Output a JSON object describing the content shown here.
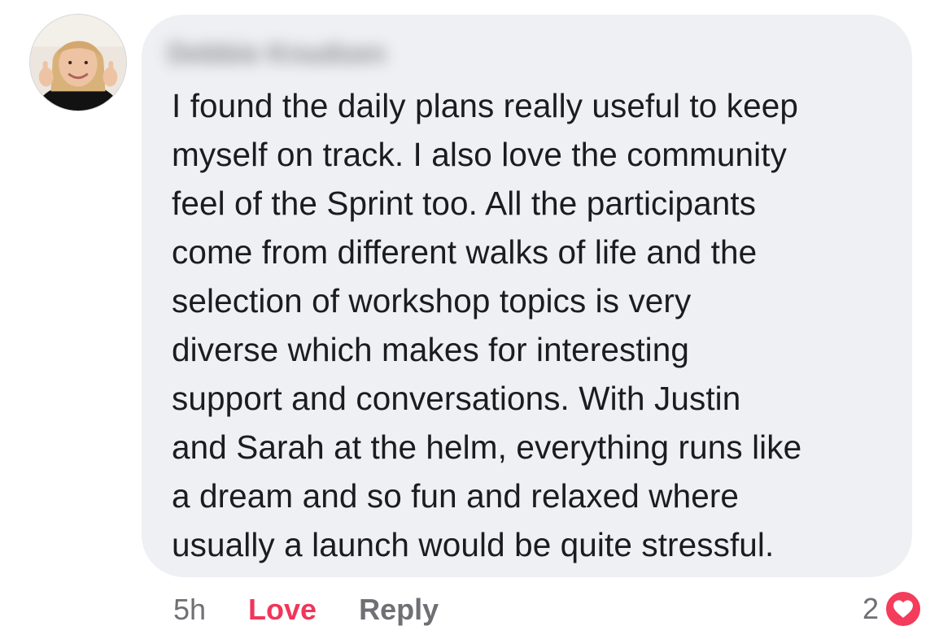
{
  "comment": {
    "author_name": "Debbie Knudsen",
    "text_lines": [
      "I found the daily plans really useful to keep",
      "myself on track.  I also love the community",
      "feel of the Sprint too.  All the participants",
      "come from different walks of life and the",
      "selection of workshop topics is very",
      "diverse which makes for interesting",
      "support and conversations.  With Justin",
      "and Sarah at the helm, everything runs like",
      "a dream and so fun and relaxed where",
      "usually a launch would be quite stressful."
    ],
    "time": "5h",
    "love_label": "Love",
    "reply_label": "Reply",
    "reaction_count": "2",
    "reaction_icon": "heart-icon",
    "colors": {
      "bubble": "#eff0f4",
      "love": "#f0365a",
      "heart_badge": "#f43c5c",
      "meta_text": "#6f6f74"
    }
  }
}
